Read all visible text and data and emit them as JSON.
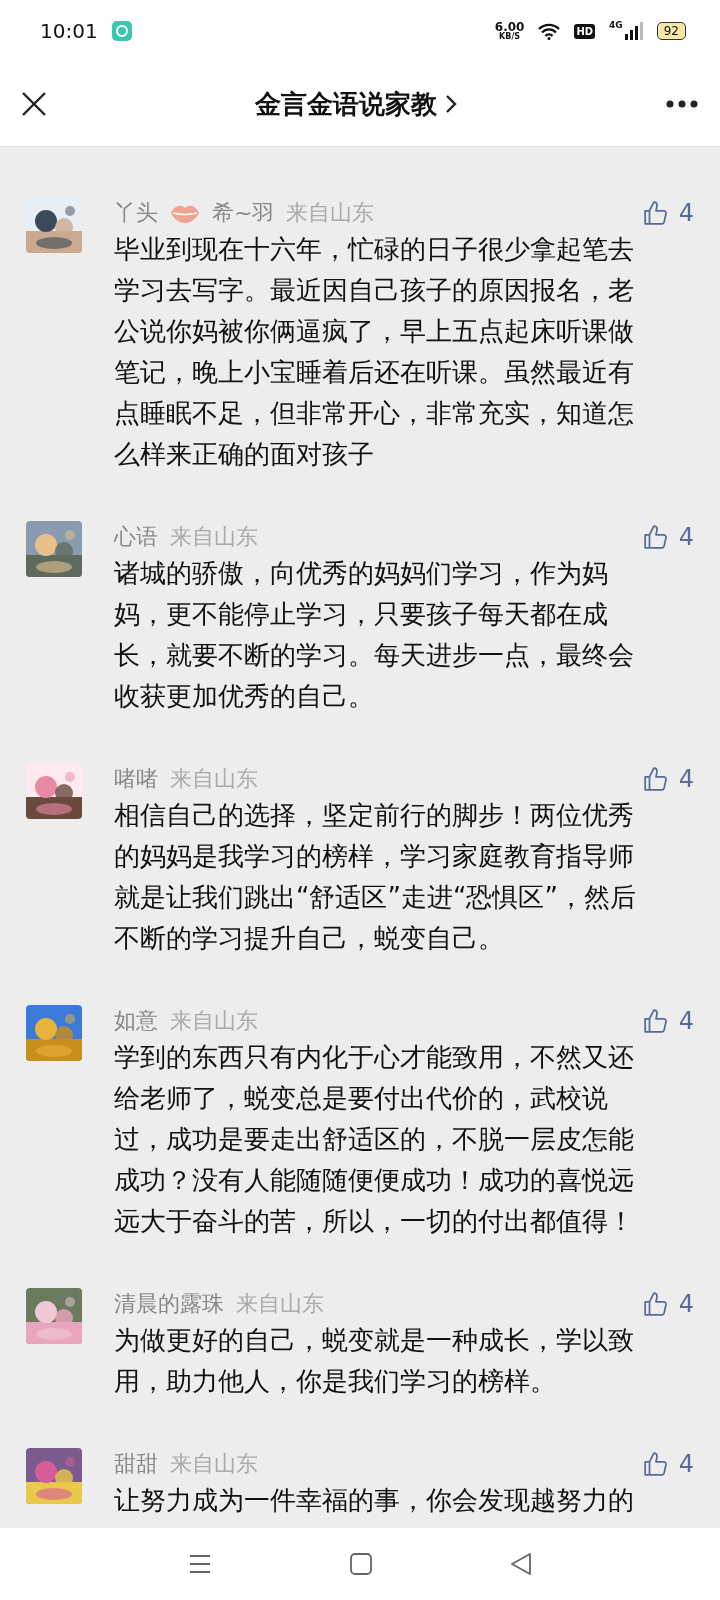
{
  "status_bar": {
    "time": "10:01",
    "speed": "6.00",
    "speed_unit": "KB/S",
    "hd": "HD",
    "network": "4G",
    "battery": "92"
  },
  "header": {
    "title": "金言金语说家教"
  },
  "comments": [
    {
      "name_parts": [
        "丫头",
        "希~羽"
      ],
      "location": "来自山东",
      "likes": "4",
      "text": "毕业到现在十六年，忙碌的日子很少拿起笔去学习去写字。最近因自己孩子的原因报名，老公说你妈被你俩逼疯了，早上五点起床听课做笔记，晚上小宝睡着后还在听课。虽然最近有点睡眠不足，但非常开心，非常充实，知道怎么样来正确的面对孩子",
      "avatar": {
        "kind": "picture"
      }
    },
    {
      "name_parts": [
        "心语"
      ],
      "location": "来自山东",
      "likes": "4",
      "text": "诸城的骄傲，向优秀的妈妈们学习，作为妈妈，更不能停止学习，只要孩子每天都在成长，就要不断的学习。每天进步一点，最终会收获更加优秀的自己。",
      "avatar": {
        "kind": "picture"
      }
    },
    {
      "name_parts": [
        "啫啫"
      ],
      "location": "来自山东",
      "likes": "4",
      "text": "相信自己的选择，坚定前行的脚步！两位优秀的妈妈是我学习的榜样，学习家庭教育指导师就是让我们跳出“舒适区”走进“恐惧区”，然后不断的学习提升自己，蜕变自己。",
      "avatar": {
        "kind": "picture"
      }
    },
    {
      "name_parts": [
        "如意"
      ],
      "location": "来自山东",
      "likes": "4",
      "text": "学到的东西只有内化于心才能致用，不然又还给老师了，蜕变总是要付出代价的，武校说过，成功是要走出舒适区的，不脱一层皮怎能成功？没有人能随随便便成功！成功的喜悦远远大于奋斗的苦，所以，一切的付出都值得！",
      "avatar": {
        "kind": "picture"
      }
    },
    {
      "name_parts": [
        "清晨的露珠"
      ],
      "location": "来自山东",
      "likes": "4",
      "text": "为做更好的自己，蜕变就是一种成长，学以致用，助力他人，你是我们学习的榜样。",
      "avatar": {
        "kind": "picture"
      }
    },
    {
      "name_parts": [
        "甜甜"
      ],
      "location": "来自山东",
      "likes": "4",
      "text": "让努力成为一件幸福的事，你会发现越努力的",
      "avatar": {
        "kind": "picture"
      }
    }
  ]
}
